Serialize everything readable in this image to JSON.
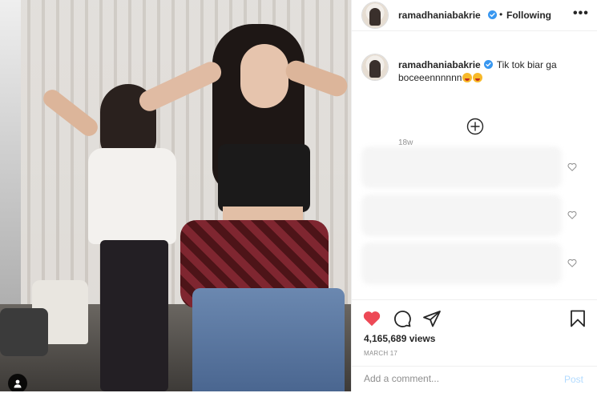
{
  "header": {
    "username": "ramadhaniabakrie",
    "separator": "•",
    "follow_status": "Following",
    "more_label": "•••"
  },
  "caption": {
    "username": "ramadhaniabakrie",
    "text": "Tik tok biar ga boceeennnnnn",
    "emojis": [
      "angry-face-emoji",
      "angry-face-emoji"
    ],
    "time_ago": "18w"
  },
  "comments": {
    "hidden_count_visible": 3
  },
  "stats": {
    "views": "4,165,689 views",
    "date": "MARCH 17"
  },
  "comment_box": {
    "placeholder": "Add a comment...",
    "post_label": "Post"
  },
  "icons": {
    "like": "heart-icon",
    "comment": "comment-icon",
    "share": "share-icon",
    "save": "bookmark-icon",
    "load_more": "plus-circle-icon",
    "user_tag": "user-tag-icon",
    "verified": "verified-badge-icon"
  },
  "colors": {
    "like_red": "#ed4956",
    "verified_blue": "#3897f0",
    "post_disabled": "#b3dbff",
    "muted": "#8e8e8e"
  }
}
